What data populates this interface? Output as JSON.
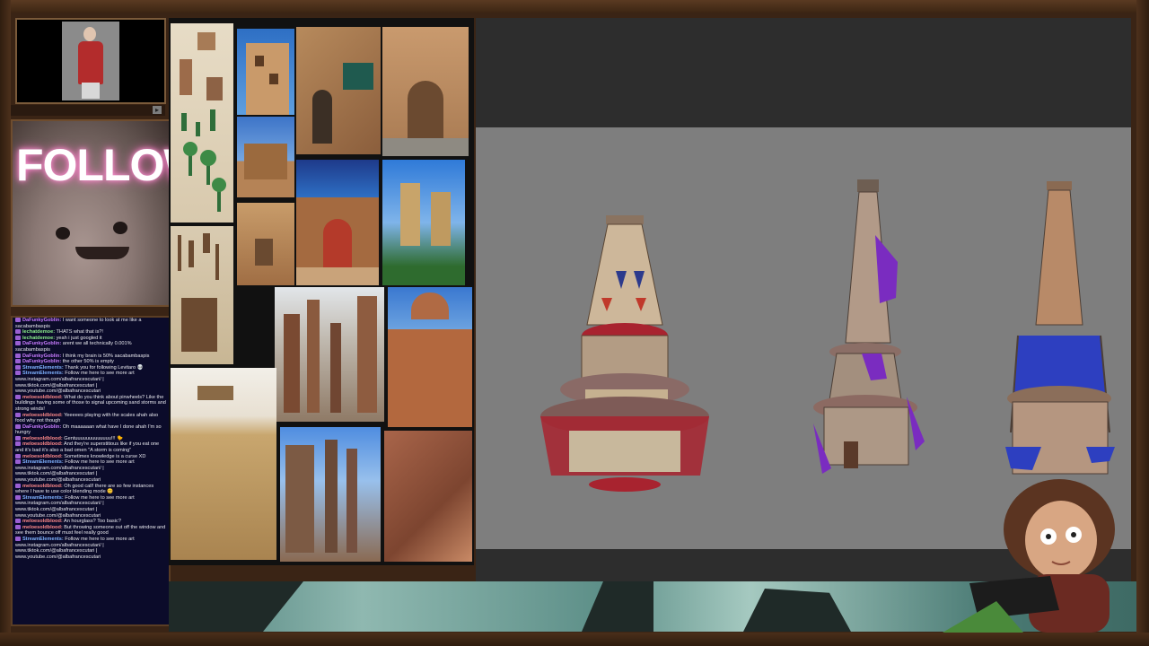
{
  "follow_panel": {
    "text": "FOLLOW"
  },
  "chat": {
    "messages": [
      {
        "user": "DaFunkyGoblin:",
        "text": " I want someone to look at me like a sacabambaspis",
        "color": "u-purple"
      },
      {
        "user": "lechatdemoe:",
        "text": " THATS what that is?!",
        "color": "u-green"
      },
      {
        "user": "lechatdemoe:",
        "text": " yeah i just googled it",
        "color": "u-green"
      },
      {
        "user": "DaFunkyGoblin:",
        "text": " arent we all technically 0.001% sacabambaspis",
        "color": "u-purple"
      },
      {
        "user": "DaFunkyGoblin:",
        "text": " I think my brain is 50% sacabambaspis",
        "color": "u-purple"
      },
      {
        "user": "DaFunkyGoblin:",
        "text": " the other 50% is empty",
        "color": "u-purple"
      },
      {
        "user": "StreamElements:",
        "text": " Thank you for following Levitaro 💀",
        "color": "u-blue"
      },
      {
        "user": "StreamElements:",
        "text": " Follow me here to see more art www.instagram.com/albafrancescutari/ | www.tiktok.com/@albafrancescutari | www.youtube.com/@albafrancescutari",
        "color": "u-blue"
      },
      {
        "user": "meloesoldblood:",
        "text": " What do you think about pinwheels? Like the buildings having some of those to signal upcoming sand storms and strong winds!",
        "color": "u-red"
      },
      {
        "user": "meloesoldblood:",
        "text": " Yeeeees playing with the scales ahah also food why not though",
        "color": "u-red"
      },
      {
        "user": "DaFunkyGoblin:",
        "text": " Oh maaaaaan what have I done ahah I'm so hungry",
        "color": "u-purple"
      },
      {
        "user": "meloesoldblood:",
        "text": " Gentuuuuuuuuuuuuu!!! 🐤",
        "color": "u-red"
      },
      {
        "user": "meloesoldblood:",
        "text": " And they're superstitious like if you eat one and it's bad it's also a bad omen \"A storm is coming\"",
        "color": "u-red"
      },
      {
        "user": "meloesoldblood:",
        "text": " Sometimes knowledge is a curse XD",
        "color": "u-red"
      },
      {
        "user": "StreamElements:",
        "text": " Follow me here to see more art www.instagram.com/albafrancescutari/ | www.tiktok.com/@albafrancescutari | www.youtube.com/@albafrancescutari",
        "color": "u-blue"
      },
      {
        "user": "meloesoldblood:",
        "text": " Oh good call! there are so few instances where I have to use color blending mode 😊",
        "color": "u-red"
      },
      {
        "user": "StreamElements:",
        "text": " Follow me here to see more art www.instagram.com/albafrancescutari/ | www.tiktok.com/@albafrancescutari | www.youtube.com/@albafrancescutari",
        "color": "u-blue"
      },
      {
        "user": "meloesoldblood:",
        "text": " An hourglass? Too basic?",
        "color": "u-red"
      },
      {
        "user": "meloesoldblood:",
        "text": " But throwing someone out off the window and see them bounce off must feel really good",
        "color": "u-red"
      },
      {
        "user": "StreamElements:",
        "text": " Follow me here to see more art www.instagram.com/albafrancescutari/ | www.tiktok.com/@albafrancescutari | www.youtube.com/@albafrancescutari",
        "color": "u-blue"
      }
    ]
  },
  "colors": {
    "frame": "#3a2415",
    "chat_bg": "#0b0b2a",
    "canvas_bg": "#7e7e7e",
    "tower_red": "#a8232f",
    "tower_purple": "#7a2cc0",
    "tower_blue": "#2d3fc0"
  }
}
